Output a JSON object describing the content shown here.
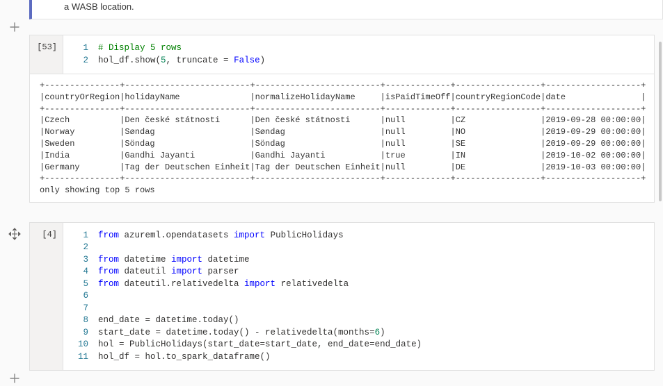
{
  "info": {
    "text": "a WASB location."
  },
  "cell1": {
    "exec_count": "[53]",
    "lines": [
      {
        "n": "1",
        "tokens": [
          [
            "kw-comment",
            "# Display 5 rows"
          ]
        ]
      },
      {
        "n": "2",
        "tokens": [
          [
            "",
            "hol_df.show("
          ],
          [
            "kw-num",
            "5"
          ],
          [
            "",
            ", truncate = "
          ],
          [
            "kw-blue",
            "False"
          ],
          [
            "",
            ")"
          ]
        ]
      }
    ]
  },
  "output1": {
    "border": "+---------------+-------------------------+-------------------------+-------------+-----------------+-------------------+",
    "header": "|countryOrRegion|holidayName              |normalizeHolidayName     |isPaidTimeOff|countryRegionCode|date               |",
    "rows": [
      "|Czech          |Den české státnosti      |Den české státnosti      |null         |CZ               |2019-09-28 00:00:00|",
      "|Norway         |Søndag                   |Søndag                   |null         |NO               |2019-09-29 00:00:00|",
      "|Sweden         |Söndag                   |Söndag                   |null         |SE               |2019-09-29 00:00:00|",
      "|India          |Gandhi Jayanti           |Gandhi Jayanti           |true         |IN               |2019-10-02 00:00:00|",
      "|Germany        |Tag der Deutschen Einheit|Tag der Deutschen Einheit|null         |DE               |2019-10-03 00:00:00|"
    ],
    "footer": "only showing top 5 rows"
  },
  "cell2": {
    "exec_count": "[4]",
    "lines": [
      {
        "n": "1",
        "tokens": [
          [
            "kw-blue",
            "from"
          ],
          [
            "",
            " azureml.opendatasets "
          ],
          [
            "kw-blue",
            "import"
          ],
          [
            "",
            " PublicHolidays"
          ]
        ]
      },
      {
        "n": "2",
        "tokens": [
          [
            "",
            ""
          ]
        ]
      },
      {
        "n": "3",
        "tokens": [
          [
            "kw-blue",
            "from"
          ],
          [
            "",
            " datetime "
          ],
          [
            "kw-blue",
            "import"
          ],
          [
            "",
            " datetime"
          ]
        ]
      },
      {
        "n": "4",
        "tokens": [
          [
            "kw-blue",
            "from"
          ],
          [
            "",
            " dateutil "
          ],
          [
            "kw-blue",
            "import"
          ],
          [
            "",
            " parser"
          ]
        ]
      },
      {
        "n": "5",
        "tokens": [
          [
            "kw-blue",
            "from"
          ],
          [
            "",
            " dateutil.relativedelta "
          ],
          [
            "kw-blue",
            "import"
          ],
          [
            "",
            " relativedelta"
          ]
        ]
      },
      {
        "n": "6",
        "tokens": [
          [
            "",
            ""
          ]
        ]
      },
      {
        "n": "7",
        "tokens": [
          [
            "",
            ""
          ]
        ]
      },
      {
        "n": "8",
        "tokens": [
          [
            "",
            "end_date = datetime.today()"
          ]
        ]
      },
      {
        "n": "9",
        "tokens": [
          [
            "",
            "start_date = datetime.today() - relativedelta(months="
          ],
          [
            "kw-num",
            "6"
          ],
          [
            "",
            ")"
          ]
        ]
      },
      {
        "n": "10",
        "tokens": [
          [
            "",
            "hol = PublicHolidays(start_date=start_date, end_date=end_date)"
          ]
        ]
      },
      {
        "n": "11",
        "tokens": [
          [
            "",
            "hol_df = hol.to_spark_dataframe()"
          ]
        ]
      }
    ]
  }
}
